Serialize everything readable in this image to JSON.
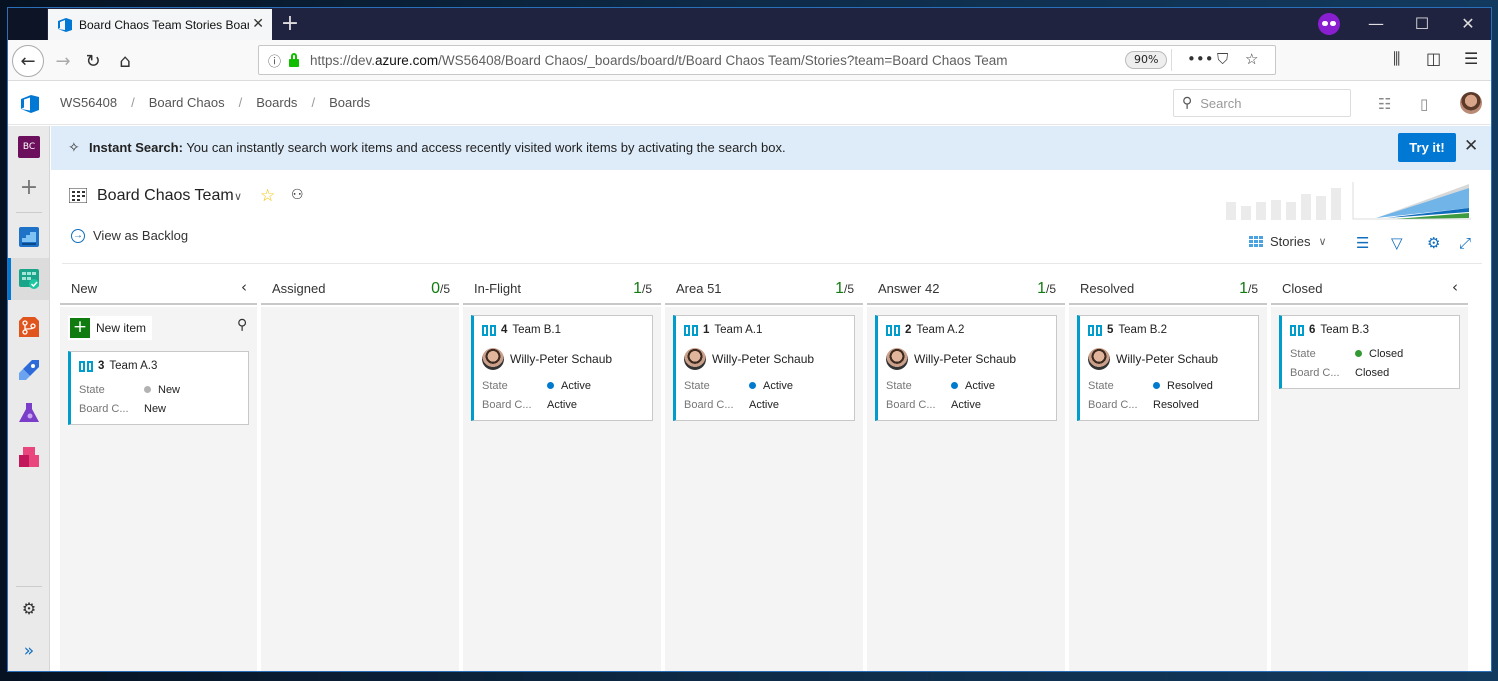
{
  "browser": {
    "tab_title": "Board Chaos Team Stories Board",
    "new_tab_label": "+",
    "url_host_prefix": "https://dev.",
    "url_host_domain": "azure.com",
    "url_path": "/WS56408/Board Chaos/_boards/board/t/Board Chaos Team/Stories?team=Board Chaos Team",
    "zoom": "90%",
    "window_controls": {
      "minimize": "—",
      "maximize": "☐",
      "close": "✕"
    }
  },
  "header": {
    "breadcrumb": [
      "WS56408",
      "Board Chaos",
      "Boards",
      "Boards"
    ],
    "search_placeholder": "Search"
  },
  "rail": {
    "project_initials": "BC",
    "items": [
      "Overview",
      "Boards",
      "Repos",
      "Pipelines",
      "Test Plans",
      "Artifacts"
    ],
    "active": "Boards"
  },
  "banner": {
    "title": "Instant Search:",
    "text": "You can instantly search work items and access recently visited work items by activating the search box.",
    "button": "Try it!"
  },
  "team": {
    "name": "Board Chaos Team",
    "view_as_backlog": "View as Backlog",
    "backlog_level": "Stories"
  },
  "colors": {
    "accent": "#0078d4",
    "story": "#009ccc",
    "state_new": "#b2b2b2",
    "state_active": "#007acc",
    "state_resolved": "#007acc",
    "state_closed": "#339933",
    "wip_ok": "#107c10"
  },
  "board": {
    "new_item_label": "New item",
    "field_labels": {
      "state": "State",
      "board_column": "Board C..."
    },
    "columns": [
      {
        "title": "New",
        "collapsible": true,
        "cards": [
          {
            "id": "3",
            "title": "Team A.3",
            "assignee": "",
            "state": "New",
            "board_column": "New",
            "state_color": "#b2b2b2"
          }
        ]
      },
      {
        "title": "Assigned",
        "wip_count": "0",
        "wip_limit": "/5",
        "cards": []
      },
      {
        "title": "In-Flight",
        "wip_count": "1",
        "wip_limit": "/5",
        "cards": [
          {
            "id": "4",
            "title": "Team B.1",
            "assignee": "Willy-Peter Schaub",
            "state": "Active",
            "board_column": "Active",
            "state_color": "#007acc"
          }
        ]
      },
      {
        "title": "Area 51",
        "wip_count": "1",
        "wip_limit": "/5",
        "cards": [
          {
            "id": "1",
            "title": "Team A.1",
            "assignee": "Willy-Peter Schaub",
            "state": "Active",
            "board_column": "Active",
            "state_color": "#007acc"
          }
        ]
      },
      {
        "title": "Answer 42",
        "wip_count": "1",
        "wip_limit": "/5",
        "cards": [
          {
            "id": "2",
            "title": "Team A.2",
            "assignee": "Willy-Peter Schaub",
            "state": "Active",
            "board_column": "Active",
            "state_color": "#007acc"
          }
        ]
      },
      {
        "title": "Resolved",
        "wip_count": "1",
        "wip_limit": "/5",
        "cards": [
          {
            "id": "5",
            "title": "Team B.2",
            "assignee": "Willy-Peter Schaub",
            "state": "Resolved",
            "board_column": "Resolved",
            "state_color": "#007acc"
          }
        ]
      },
      {
        "title": "Closed",
        "collapsible": true,
        "cards": [
          {
            "id": "6",
            "title": "Team B.3",
            "assignee": "",
            "state": "Closed",
            "board_column": "Closed",
            "state_color": "#339933"
          }
        ]
      }
    ]
  }
}
